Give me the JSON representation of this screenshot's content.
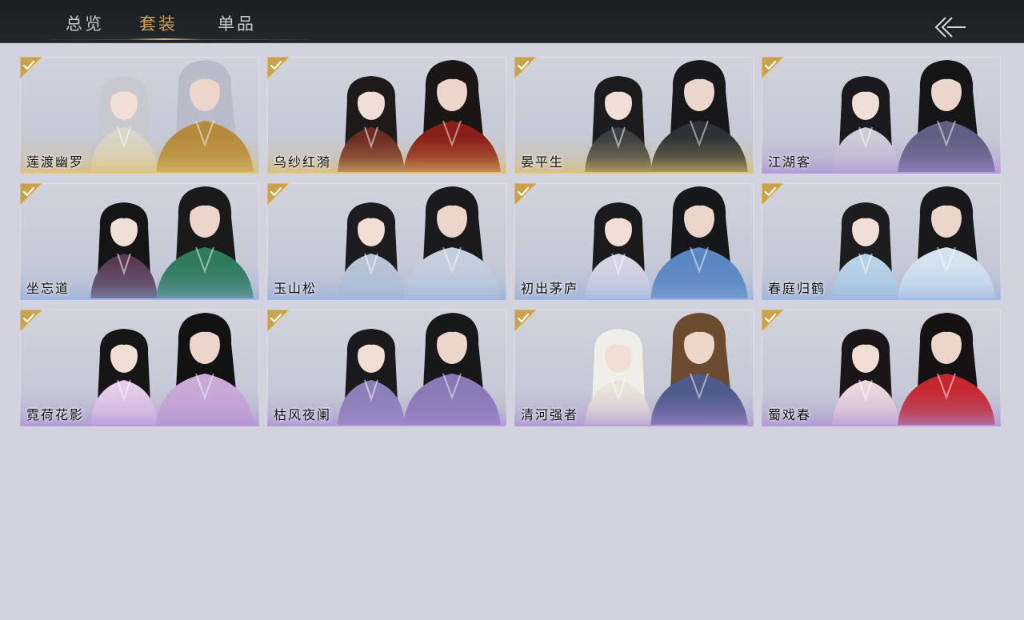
{
  "tabs": [
    {
      "label": "总览",
      "active": false
    },
    {
      "label": "套装",
      "active": true
    },
    {
      "label": "单品",
      "active": false
    }
  ],
  "back_button": {
    "icon": "double-chevron-left-arrow-icon"
  },
  "colors": {
    "topbar": "#1b1e22",
    "page_bg": "#d3d3df",
    "active_tab": "#c8a25c",
    "inactive_tab": "#c9c9c9",
    "badge_gold": "#c9a24e"
  },
  "outfits": [
    {
      "name": "莲渡幽罗",
      "owned": true,
      "tier": "gold",
      "hair_left": "#c8c8d0",
      "hair_right": "#b9bcc8",
      "robe_left": "#d9d4c8",
      "robe_right": "#b58a3c"
    },
    {
      "name": "乌纱红漪",
      "owned": true,
      "tier": "gold",
      "hair_left": "#1e1a1a",
      "hair_right": "#1a1616",
      "robe_left": "#6b2a22",
      "robe_right": "#8a1f1a"
    },
    {
      "name": "晏平生",
      "owned": true,
      "tier": "gold",
      "hair_left": "#1c1c1e",
      "hair_right": "#18181a",
      "robe_left": "#3c3f42",
      "robe_right": "#2e3236"
    },
    {
      "name": "江湖客",
      "owned": true,
      "tier": "purple",
      "hair_left": "#1a1a1e",
      "hair_right": "#151518",
      "robe_left": "#cfcbd8",
      "robe_right": "#5e5f82"
    },
    {
      "name": "坐忘道",
      "owned": true,
      "tier": "blue",
      "hair_left": "#151515",
      "hair_right": "#1a1a1a",
      "robe_left": "#5a3a52",
      "robe_right": "#2f7a5a"
    },
    {
      "name": "玉山松",
      "owned": true,
      "tier": "blue",
      "hair_left": "#1c1c1f",
      "hair_right": "#1a1a1d",
      "robe_left": "#b9c4d4",
      "robe_right": "#c5cedc"
    },
    {
      "name": "初出茅庐",
      "owned": true,
      "tier": "blue",
      "hair_left": "#1a1a1c",
      "hair_right": "#16171a",
      "robe_left": "#d6d4e4",
      "robe_right": "#5a86c2"
    },
    {
      "name": "春庭归鹤",
      "owned": true,
      "tier": "blue",
      "hair_left": "#1d1c1e",
      "hair_right": "#19191b",
      "robe_left": "#b8d2e6",
      "robe_right": "#d4e2ef"
    },
    {
      "name": "霓荷花影",
      "owned": true,
      "tier": "purple",
      "hair_left": "#151515",
      "hair_right": "#121212",
      "robe_left": "#e3cde8",
      "robe_right": "#c9a9d6"
    },
    {
      "name": "枯风夜阑",
      "owned": true,
      "tier": "purple",
      "hair_left": "#1a1a1c",
      "hair_right": "#18181a",
      "robe_left": "#8b7fb8",
      "robe_right": "#8a79b6"
    },
    {
      "name": "清河强者",
      "owned": true,
      "tier": "purple",
      "hair_left": "#f0eee8",
      "hair_right": "#6b4a2e",
      "robe_left": "#e9e4d8",
      "robe_right": "#4e5a8a"
    },
    {
      "name": "蜀戏春",
      "owned": true,
      "tier": "purple",
      "hair_left": "#1a1516",
      "hair_right": "#161213",
      "robe_left": "#e8d7dc",
      "robe_right": "#c4282e"
    }
  ]
}
